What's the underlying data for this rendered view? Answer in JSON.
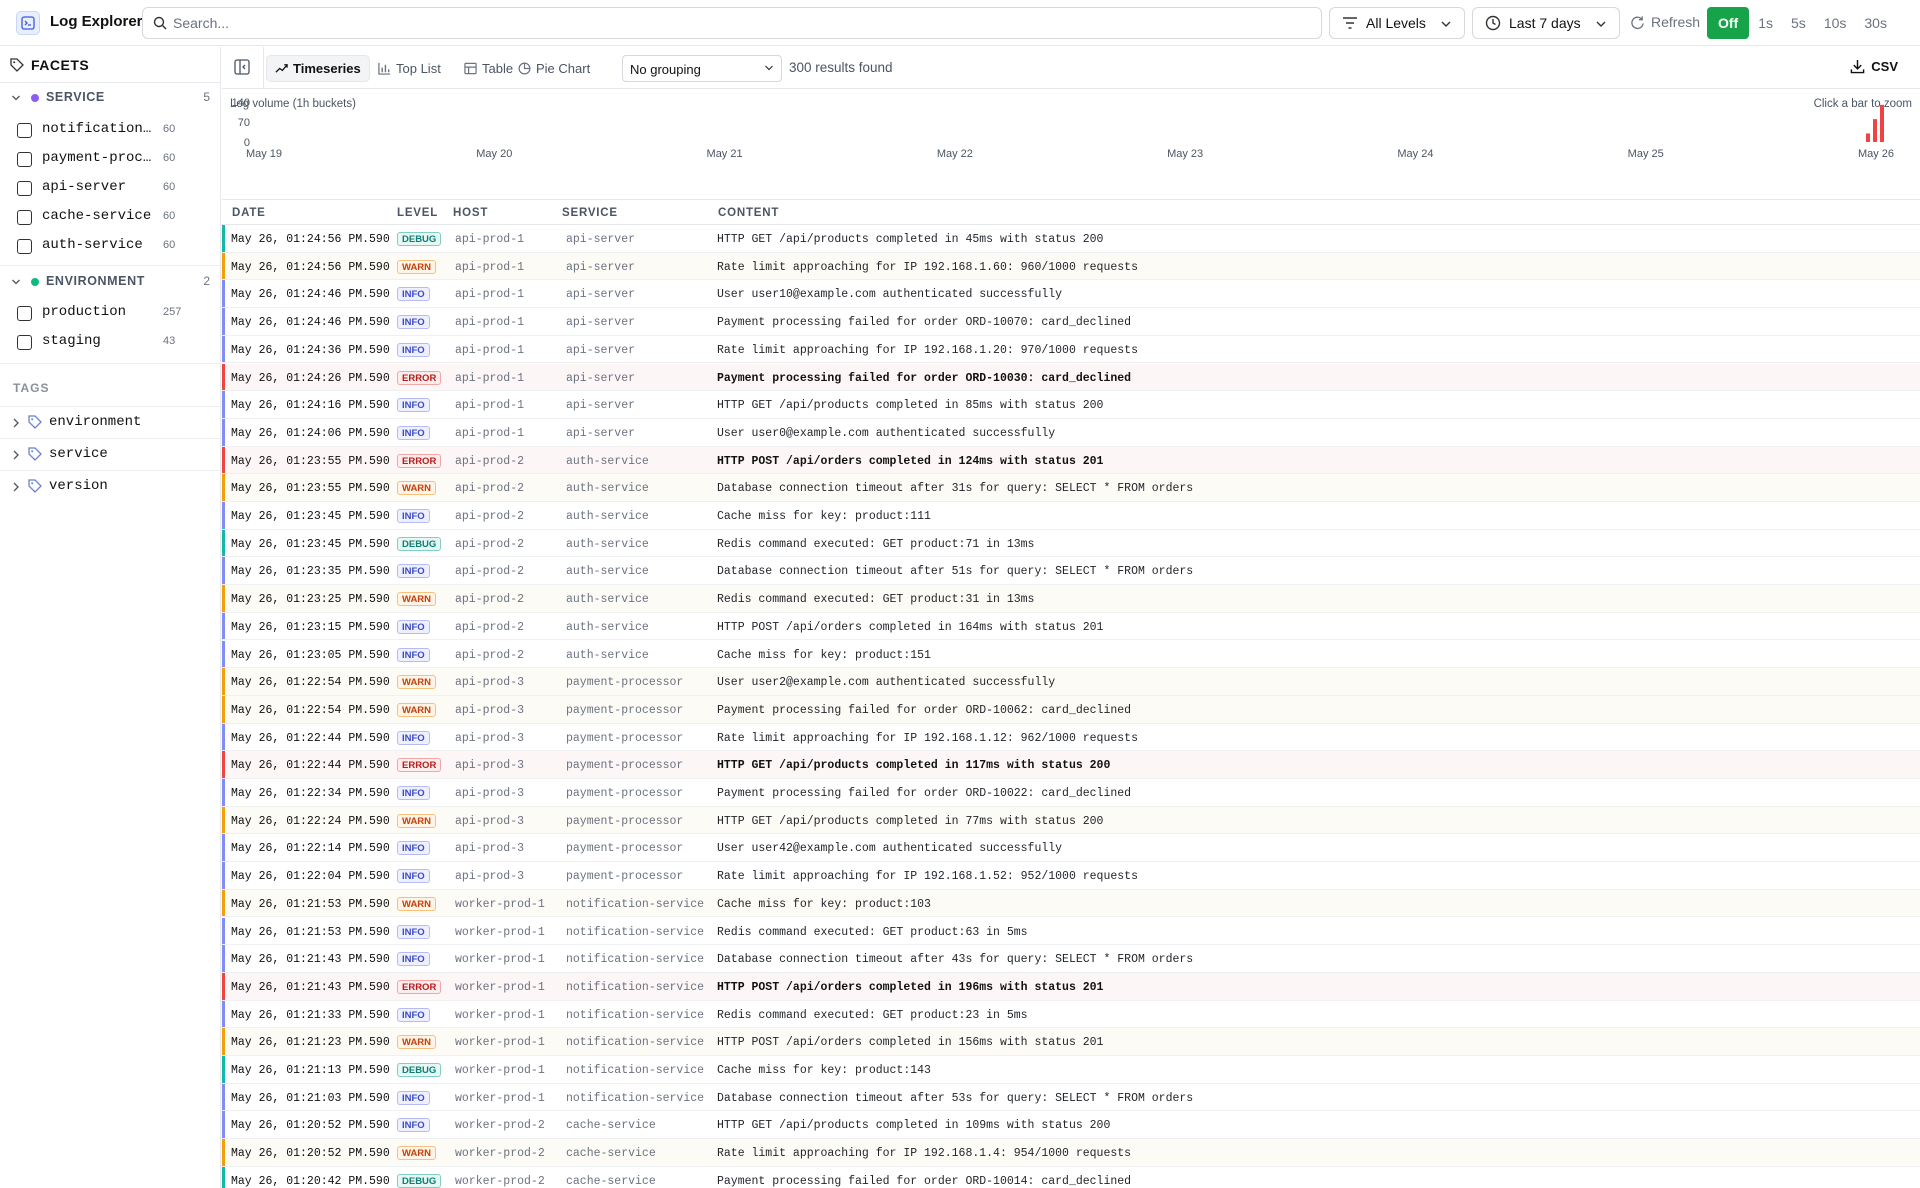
{
  "app": {
    "title": "Log Explorer"
  },
  "search": {
    "placeholder": "Search..."
  },
  "filters": {
    "levels_label": "All Levels",
    "time_label": "Last 7 days",
    "refresh_label": "Refresh",
    "rates": [
      "Off",
      "1s",
      "5s",
      "10s",
      "30s"
    ],
    "active_rate": "Off"
  },
  "sidebar": {
    "facets_title": "FACETS",
    "groups": [
      {
        "name": "SERVICE",
        "count": "5",
        "color": "#8b5cf6",
        "items": [
          {
            "label": "notification-service",
            "count": "60"
          },
          {
            "label": "payment-processor",
            "count": "60"
          },
          {
            "label": "api-server",
            "count": "60"
          },
          {
            "label": "cache-service",
            "count": "60"
          },
          {
            "label": "auth-service",
            "count": "60"
          }
        ]
      },
      {
        "name": "ENVIRONMENT",
        "count": "2",
        "color": "#10b981",
        "items": [
          {
            "label": "production",
            "count": "257"
          },
          {
            "label": "staging",
            "count": "43"
          }
        ]
      }
    ],
    "tags_title": "TAGS",
    "tags": [
      "environment",
      "service",
      "version"
    ]
  },
  "toolbar": {
    "tabs": [
      "Timeseries",
      "Top List",
      "Table",
      "Pie Chart"
    ],
    "active_tab": "Timeseries",
    "grouping": "No grouping",
    "results": "300 results found",
    "csv": "CSV"
  },
  "chart_data": {
    "type": "bar",
    "title": "Log volume (1h buckets)",
    "hint": "Click a bar to zoom",
    "y_ticks": [
      "140",
      "70",
      "0"
    ],
    "ylim": [
      0,
      140
    ],
    "x_ticks": [
      "May 19",
      "May 20",
      "May 21",
      "May 22",
      "May 23",
      "May 24",
      "May 25",
      "May 26"
    ],
    "series": [
      {
        "bucket": "May 26 10:00",
        "value": 30
      },
      {
        "bucket": "May 26 11:00",
        "value": 80
      },
      {
        "bucket": "May 26 12:00",
        "value": 130
      }
    ],
    "bar_color": "#ef4444"
  },
  "table": {
    "headers": {
      "date": "DATE",
      "level": "LEVEL",
      "host": "HOST",
      "service": "SERVICE",
      "content": "CONTENT"
    },
    "level_colors": {
      "DEBUG": "#14b8a6",
      "WARN": "#f59e0b",
      "INFO": "#818cf8",
      "ERROR": "#ef4444"
    },
    "rows": [
      {
        "date": "May 26, 01:24:56 PM.590",
        "level": "DEBUG",
        "host": "api-prod-1",
        "service": "api-server",
        "content": "HTTP GET /api/products completed in 45ms with status 200"
      },
      {
        "date": "May 26, 01:24:56 PM.590",
        "level": "WARN",
        "host": "api-prod-1",
        "service": "api-server",
        "content": "Rate limit approaching for IP 192.168.1.60: 960/1000 requests"
      },
      {
        "date": "May 26, 01:24:46 PM.590",
        "level": "INFO",
        "host": "api-prod-1",
        "service": "api-server",
        "content": "User user10@example.com authenticated successfully"
      },
      {
        "date": "May 26, 01:24:46 PM.590",
        "level": "INFO",
        "host": "api-prod-1",
        "service": "api-server",
        "content": "Payment processing failed for order ORD-10070: card_declined"
      },
      {
        "date": "May 26, 01:24:36 PM.590",
        "level": "INFO",
        "host": "api-prod-1",
        "service": "api-server",
        "content": "Rate limit approaching for IP 192.168.1.20: 970/1000 requests"
      },
      {
        "date": "May 26, 01:24:26 PM.590",
        "level": "ERROR",
        "host": "api-prod-1",
        "service": "api-server",
        "content": "Payment processing failed for order ORD-10030: card_declined"
      },
      {
        "date": "May 26, 01:24:16 PM.590",
        "level": "INFO",
        "host": "api-prod-1",
        "service": "api-server",
        "content": "HTTP GET /api/products completed in 85ms with status 200"
      },
      {
        "date": "May 26, 01:24:06 PM.590",
        "level": "INFO",
        "host": "api-prod-1",
        "service": "api-server",
        "content": "User user0@example.com authenticated successfully"
      },
      {
        "date": "May 26, 01:23:55 PM.590",
        "level": "ERROR",
        "host": "api-prod-2",
        "service": "auth-service",
        "content": "HTTP POST /api/orders completed in 124ms with status 201"
      },
      {
        "date": "May 26, 01:23:55 PM.590",
        "level": "WARN",
        "host": "api-prod-2",
        "service": "auth-service",
        "content": "Database connection timeout after 31s for query: SELECT * FROM orders"
      },
      {
        "date": "May 26, 01:23:45 PM.590",
        "level": "INFO",
        "host": "api-prod-2",
        "service": "auth-service",
        "content": "Cache miss for key: product:111"
      },
      {
        "date": "May 26, 01:23:45 PM.590",
        "level": "DEBUG",
        "host": "api-prod-2",
        "service": "auth-service",
        "content": "Redis command executed: GET product:71 in 13ms"
      },
      {
        "date": "May 26, 01:23:35 PM.590",
        "level": "INFO",
        "host": "api-prod-2",
        "service": "auth-service",
        "content": "Database connection timeout after 51s for query: SELECT * FROM orders"
      },
      {
        "date": "May 26, 01:23:25 PM.590",
        "level": "WARN",
        "host": "api-prod-2",
        "service": "auth-service",
        "content": "Redis command executed: GET product:31 in 13ms"
      },
      {
        "date": "May 26, 01:23:15 PM.590",
        "level": "INFO",
        "host": "api-prod-2",
        "service": "auth-service",
        "content": "HTTP POST /api/orders completed in 164ms with status 201"
      },
      {
        "date": "May 26, 01:23:05 PM.590",
        "level": "INFO",
        "host": "api-prod-2",
        "service": "auth-service",
        "content": "Cache miss for key: product:151"
      },
      {
        "date": "May 26, 01:22:54 PM.590",
        "level": "WARN",
        "host": "api-prod-3",
        "service": "payment-processor",
        "content": "User user2@example.com authenticated successfully"
      },
      {
        "date": "May 26, 01:22:54 PM.590",
        "level": "WARN",
        "host": "api-prod-3",
        "service": "payment-processor",
        "content": "Payment processing failed for order ORD-10062: card_declined"
      },
      {
        "date": "May 26, 01:22:44 PM.590",
        "level": "INFO",
        "host": "api-prod-3",
        "service": "payment-processor",
        "content": "Rate limit approaching for IP 192.168.1.12: 962/1000 requests"
      },
      {
        "date": "May 26, 01:22:44 PM.590",
        "level": "ERROR",
        "host": "api-prod-3",
        "service": "payment-processor",
        "content": "HTTP GET /api/products completed in 117ms with status 200"
      },
      {
        "date": "May 26, 01:22:34 PM.590",
        "level": "INFO",
        "host": "api-prod-3",
        "service": "payment-processor",
        "content": "Payment processing failed for order ORD-10022: card_declined"
      },
      {
        "date": "May 26, 01:22:24 PM.590",
        "level": "WARN",
        "host": "api-prod-3",
        "service": "payment-processor",
        "content": "HTTP GET /api/products completed in 77ms with status 200"
      },
      {
        "date": "May 26, 01:22:14 PM.590",
        "level": "INFO",
        "host": "api-prod-3",
        "service": "payment-processor",
        "content": "User user42@example.com authenticated successfully"
      },
      {
        "date": "May 26, 01:22:04 PM.590",
        "level": "INFO",
        "host": "api-prod-3",
        "service": "payment-processor",
        "content": "Rate limit approaching for IP 192.168.1.52: 952/1000 requests"
      },
      {
        "date": "May 26, 01:21:53 PM.590",
        "level": "WARN",
        "host": "worker-prod-1",
        "service": "notification-service",
        "content": "Cache miss for key: product:103"
      },
      {
        "date": "May 26, 01:21:53 PM.590",
        "level": "INFO",
        "host": "worker-prod-1",
        "service": "notification-service",
        "content": "Redis command executed: GET product:63 in 5ms"
      },
      {
        "date": "May 26, 01:21:43 PM.590",
        "level": "INFO",
        "host": "worker-prod-1",
        "service": "notification-service",
        "content": "Database connection timeout after 43s for query: SELECT * FROM orders"
      },
      {
        "date": "May 26, 01:21:43 PM.590",
        "level": "ERROR",
        "host": "worker-prod-1",
        "service": "notification-service",
        "content": "HTTP POST /api/orders completed in 196ms with status 201"
      },
      {
        "date": "May 26, 01:21:33 PM.590",
        "level": "INFO",
        "host": "worker-prod-1",
        "service": "notification-service",
        "content": "Redis command executed: GET product:23 in 5ms"
      },
      {
        "date": "May 26, 01:21:23 PM.590",
        "level": "WARN",
        "host": "worker-prod-1",
        "service": "notification-service",
        "content": "HTTP POST /api/orders completed in 156ms with status 201"
      },
      {
        "date": "May 26, 01:21:13 PM.590",
        "level": "DEBUG",
        "host": "worker-prod-1",
        "service": "notification-service",
        "content": "Cache miss for key: product:143"
      },
      {
        "date": "May 26, 01:21:03 PM.590",
        "level": "INFO",
        "host": "worker-prod-1",
        "service": "notification-service",
        "content": "Database connection timeout after 53s for query: SELECT * FROM orders"
      },
      {
        "date": "May 26, 01:20:52 PM.590",
        "level": "INFO",
        "host": "worker-prod-2",
        "service": "cache-service",
        "content": "HTTP GET /api/products completed in 109ms with status 200"
      },
      {
        "date": "May 26, 01:20:52 PM.590",
        "level": "WARN",
        "host": "worker-prod-2",
        "service": "cache-service",
        "content": "Rate limit approaching for IP 192.168.1.4: 954/1000 requests"
      },
      {
        "date": "May 26, 01:20:42 PM.590",
        "level": "DEBUG",
        "host": "worker-prod-2",
        "service": "cache-service",
        "content": "Payment processing failed for order ORD-10014: card_declined"
      }
    ]
  }
}
